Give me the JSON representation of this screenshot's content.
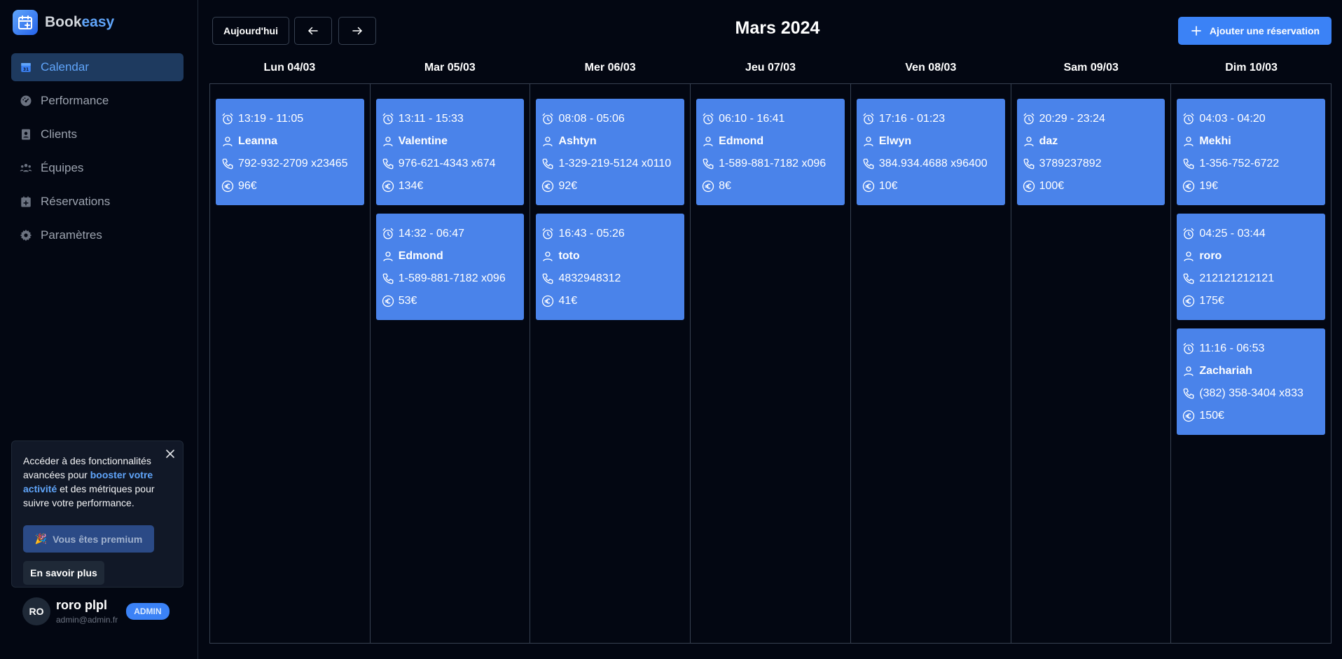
{
  "app": {
    "brand_part1": "Book",
    "brand_part2": "easy"
  },
  "sidebar": {
    "items": [
      {
        "label": "Calendar",
        "icon": "calendar-icon",
        "active": true
      },
      {
        "label": "Performance",
        "icon": "gauge-icon",
        "active": false
      },
      {
        "label": "Clients",
        "icon": "contact-icon",
        "active": false
      },
      {
        "label": "Équipes",
        "icon": "users-icon",
        "active": false
      },
      {
        "label": "Réservations",
        "icon": "calendar-plus-icon",
        "active": false
      },
      {
        "label": "Paramètres",
        "icon": "gear-icon",
        "active": false
      }
    ]
  },
  "promo": {
    "text_before": "Accéder à des fonctionnalités avancées pour ",
    "highlight": "booster votre activité",
    "text_after": " et des métriques pour suivre votre performance.",
    "premium_label": "Vous êtes premium",
    "premium_emoji": "🎉",
    "learn_more_label": "En savoir plus"
  },
  "user": {
    "initials": "RO",
    "name": "roro plpl",
    "email": "admin@admin.fr",
    "role": "ADMIN"
  },
  "header": {
    "today_label": "Aujourd'hui",
    "month_title": "Mars 2024",
    "add_label": "Ajouter une réservation"
  },
  "days": [
    {
      "label": "Lun 04/03",
      "bookings": [
        {
          "time": "13:19 - 11:05",
          "name": "Leanna",
          "phone": "792-932-2709 x23465",
          "price": "96€"
        }
      ]
    },
    {
      "label": "Mar 05/03",
      "bookings": [
        {
          "time": "13:11 - 15:33",
          "name": "Valentine",
          "phone": "976-621-4343 x674",
          "price": "134€"
        },
        {
          "time": "14:32 - 06:47",
          "name": "Edmond",
          "phone": "1-589-881-7182 x096",
          "price": "53€"
        }
      ]
    },
    {
      "label": "Mer 06/03",
      "bookings": [
        {
          "time": "08:08 - 05:06",
          "name": "Ashtyn",
          "phone": "1-329-219-5124 x0110",
          "price": "92€"
        },
        {
          "time": "16:43 - 05:26",
          "name": "toto",
          "phone": "4832948312",
          "price": "41€"
        }
      ]
    },
    {
      "label": "Jeu 07/03",
      "bookings": [
        {
          "time": "06:10 - 16:41",
          "name": "Edmond",
          "phone": "1-589-881-7182 x096",
          "price": "8€"
        }
      ]
    },
    {
      "label": "Ven 08/03",
      "bookings": [
        {
          "time": "17:16 - 01:23",
          "name": "Elwyn",
          "phone": "384.934.4688 x96400",
          "price": "10€"
        }
      ]
    },
    {
      "label": "Sam 09/03",
      "bookings": [
        {
          "time": "20:29 - 23:24",
          "name": "daz",
          "phone": "3789237892",
          "price": "100€"
        }
      ]
    },
    {
      "label": "Dim 10/03",
      "bookings": [
        {
          "time": "04:03 - 04:20",
          "name": "Mekhi",
          "phone": "1-356-752-6722",
          "price": "19€"
        },
        {
          "time": "04:25 - 03:44",
          "name": "roro",
          "phone": "212121212121",
          "price": "175€"
        },
        {
          "time": "11:16 - 06:53",
          "name": "Zachariah",
          "phone": "(382) 358-3404 x833",
          "price": "150€"
        }
      ]
    }
  ]
}
